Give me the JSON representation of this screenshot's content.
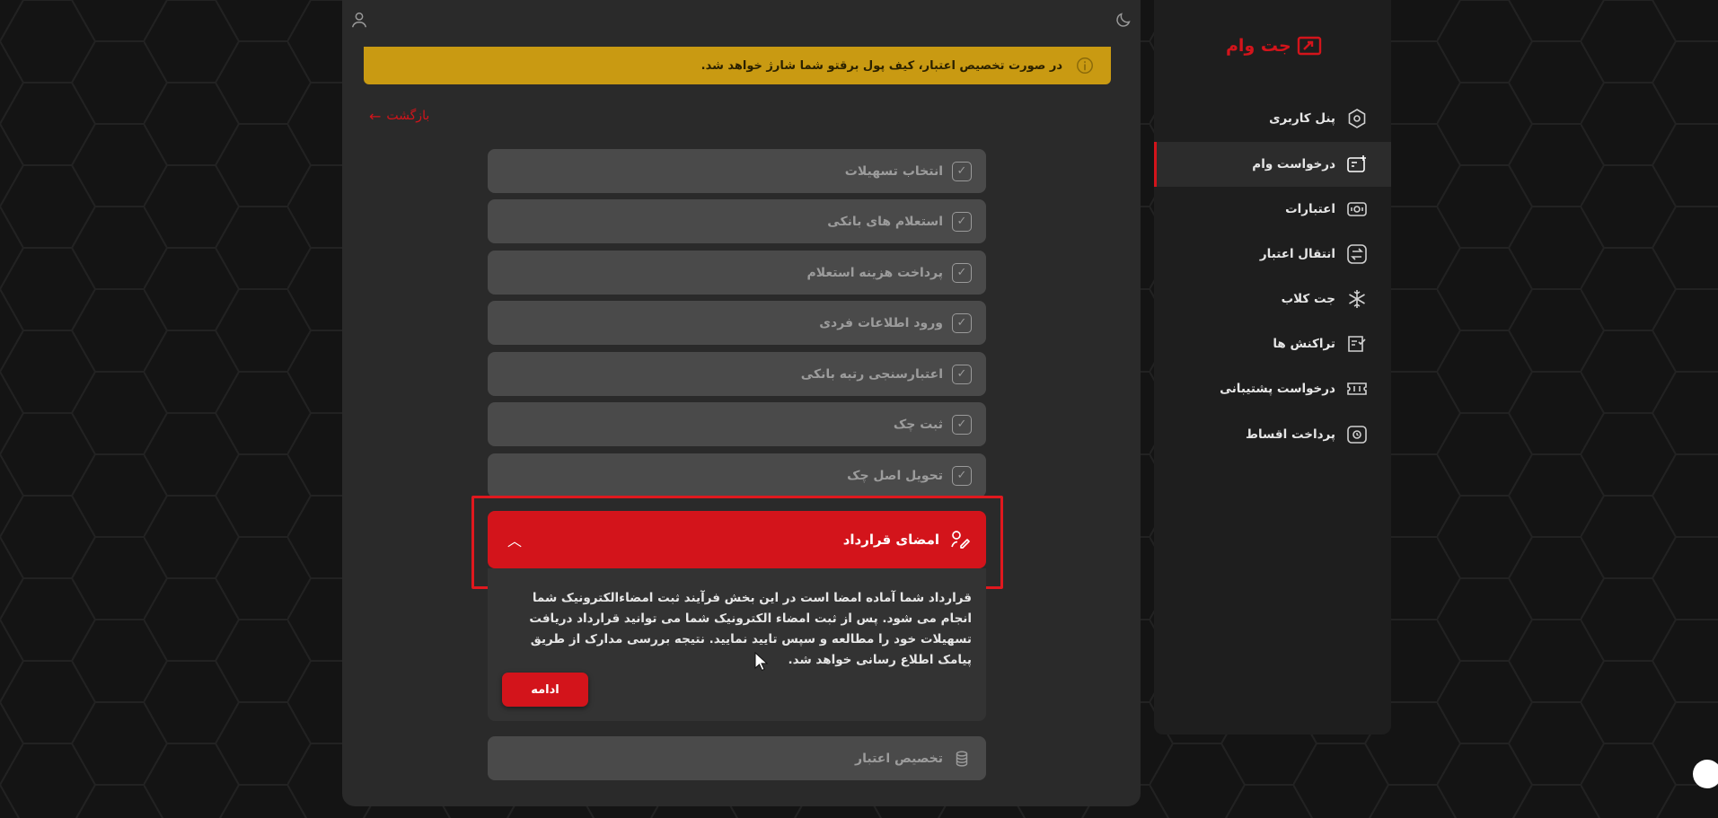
{
  "alert": {
    "text": "در صورت تخصیص اعتبار، کیف پول برقتو شما شارژ خواهد شد."
  },
  "back_link": {
    "label": "بازگشت"
  },
  "steps": [
    {
      "label": "انتخاب تسهیلات",
      "status": "done",
      "icon": "check-icon"
    },
    {
      "label": "استعلام های بانکی",
      "status": "done",
      "icon": "check-icon"
    },
    {
      "label": "پرداخت هزینه استعلام",
      "status": "done",
      "icon": "check-icon"
    },
    {
      "label": "ورود اطلاعات فردی",
      "status": "done",
      "icon": "check-icon"
    },
    {
      "label": "اعتبارسنجی رتبه بانکی",
      "status": "done",
      "icon": "check-icon"
    },
    {
      "label": "ثبت چک",
      "status": "done",
      "icon": "check-icon"
    },
    {
      "label": "تحویل اصل چک",
      "status": "done",
      "icon": "check-icon"
    }
  ],
  "active_step": {
    "label": "امضای قرارداد",
    "icon": "signature-icon",
    "description": "قرارداد شما آماده امضا است در این بخش فرآیند ثبت امضاءالکترونیک شما انجام می شود. پس از ثبت امضاء الکترونیک شما می توانید قرارداد دریافت تسهیلات خود را مطالعه و سپس تایید نمایید. نتیجه بررسی مدارک از طریق پیامک اطلاع رسانی خواهد شد.",
    "button_label": "ادامه"
  },
  "final_step": {
    "label": "تخصیص اعتبار",
    "icon": "coins-icon"
  },
  "sidebar": {
    "brand": "جت وام",
    "items": [
      {
        "label": "پنل کاربری",
        "icon": "hexagon-icon",
        "active": false
      },
      {
        "label": "درخواست وام",
        "icon": "wallet-plus-icon",
        "active": true
      },
      {
        "label": "اعتبارات",
        "icon": "credit-icon",
        "active": false
      },
      {
        "label": "انتقال اعتبار",
        "icon": "transfer-icon",
        "active": false
      },
      {
        "label": "جت کلاب",
        "icon": "snowflake-icon",
        "active": false
      },
      {
        "label": "تراکنش ها",
        "icon": "receipt-icon",
        "active": false
      },
      {
        "label": "درخواست پشتیبانی",
        "icon": "ticket-icon",
        "active": false
      },
      {
        "label": "پرداخت اقساط",
        "icon": "installment-icon",
        "active": false
      }
    ]
  },
  "colors": {
    "accent": "#d3141b",
    "warning": "#c99a12",
    "card": "#2a2a2a",
    "step": "#4a4a4a",
    "sidebar": "#1e1e1e"
  }
}
